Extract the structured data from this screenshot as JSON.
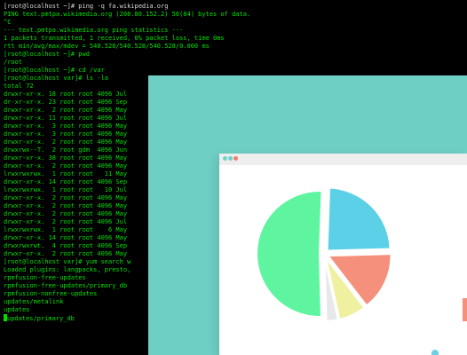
{
  "terminal": {
    "lines": [
      "[root@localhost ~]# ping -q fa.wikipedia.org",
      "PING text.pmtpa.wikimedia.org (208.80.152.2) 56(84) bytes of data.",
      "^C",
      "--- text.pmtpa.wikimedia.org ping statistics ---",
      "1 packets transmitted, 1 received, 0% packet loss, time 0ms",
      "rtt min/avg/max/mdev = 540.528/540.528/540.528/0.000 ms",
      "[root@localhost ~]# pwd",
      "/root",
      "[root@localhost ~]# cd /var",
      "[root@localhost var]# ls -la",
      "total 72",
      "drwxr-xr-x. 18 root root 4096 Jul",
      "dr-xr-xr-x. 23 root root 4096 Sep",
      "drwxr-xr-x.  2 root root 4096 May",
      "drwxr-xr-x. 11 root root 4096 Jul",
      "drwxr-xr-x.  3 root root 4096 May",
      "drwxr-xr-x.  3 root root 4096 May",
      "drwxr-xr-x.  2 root root 4096 May",
      "drwxrwx--T.  2 root gdm  4096 Jun",
      "drwxr-xr-x. 38 root root 4096 May",
      "drwxr-xr-x.  2 root root 4096 May",
      "lrwxrwxrwx.  1 root root   11 May",
      "drwxr-xr-x. 14 root root 4096 Sep",
      "lrwxrwxrwx.  1 root root   10 Jul",
      "drwxr-xr-x.  2 root root 4096 May",
      "drwxr-xr-x.  2 root root 4096 May",
      "drwxr-xr-x.  2 root root 4096 May",
      "drwxr-xr-x.  2 root root 4096 Jul",
      "lrwxrwxrwx.  1 root root    6 May",
      "drwxr-xr-x. 14 root root 4096 May",
      "drwxrwxrwt.  4 root root 4096 Sep",
      "drwxr-xr-x.  2 root root 4096 May",
      "[root@localhost var]# yum search w",
      "Loaded plugins: langpacks, presto,",
      "rpmfusion-free-updates",
      "rpmfusion-free-updates/primary_db",
      "rpmfusion-nonfree-updates",
      "updates/metalink",
      "updates",
      "updates/primary_db"
    ]
  },
  "colors": {
    "terminal_text": "#00e000",
    "teal_background": "#6ecfc4",
    "slice_cyan": "#5cd0e6",
    "slice_salmon": "#f4907c",
    "slice_yellow": "#eff0a0",
    "slice_grey": "#e8e8e8",
    "slice_green": "#5ff5a0"
  },
  "chart_data": {
    "type": "pie",
    "values": [
      24,
      15,
      7,
      3,
      51
    ],
    "colors": [
      "#5cd0e6",
      "#f4907c",
      "#eff0a0",
      "#e8e8e8",
      "#5ff5a0"
    ],
    "exploded": [
      true,
      true,
      true,
      true,
      true
    ]
  }
}
